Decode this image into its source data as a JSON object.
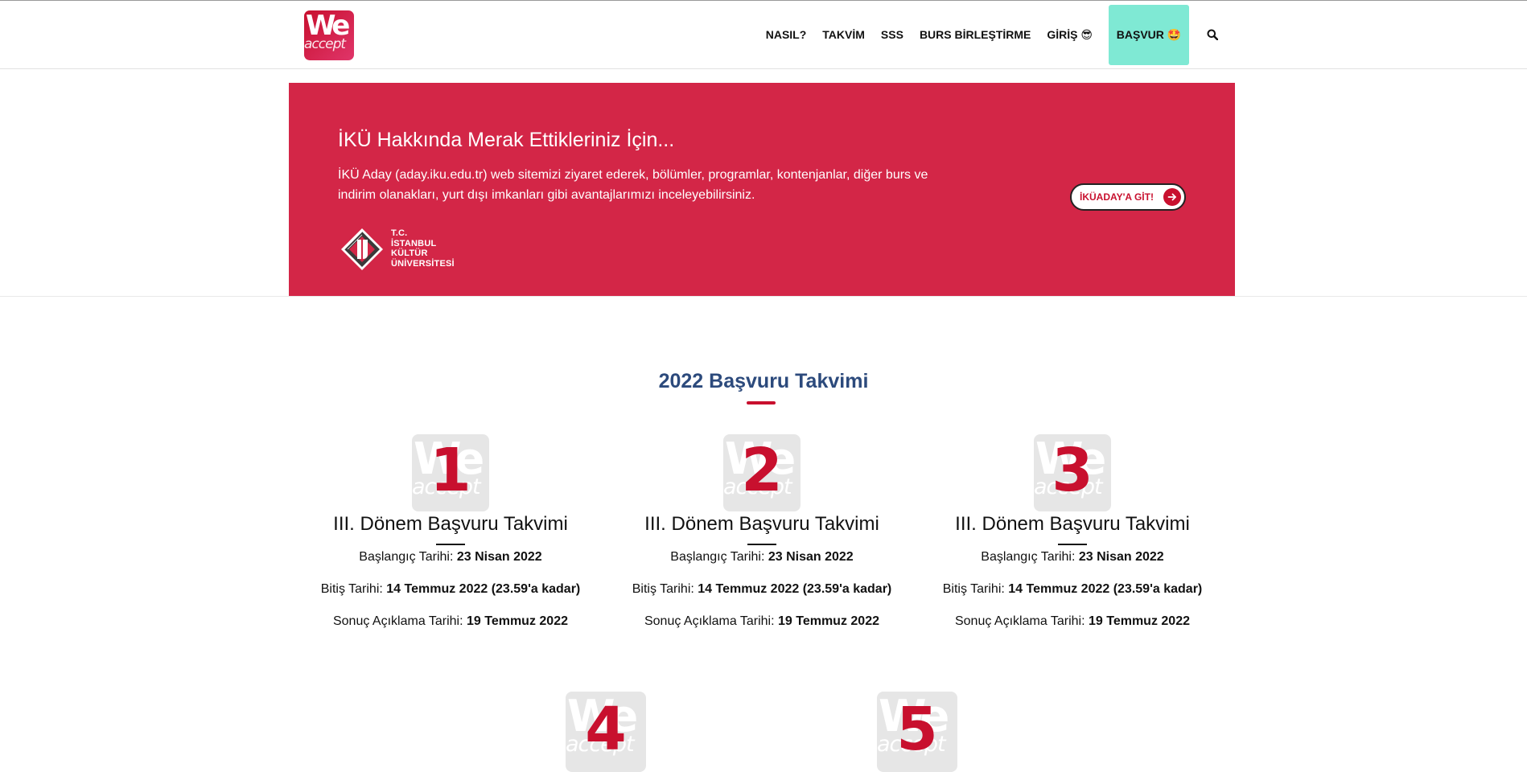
{
  "header": {
    "logo": {
      "line1": "We",
      "line2": "accept"
    },
    "nav": [
      {
        "label": "NASIL?"
      },
      {
        "label": "TAKVİM"
      },
      {
        "label": "SSS"
      },
      {
        "label": "BURS BİRLEŞTİRME"
      },
      {
        "label": "GİRİŞ 😎"
      }
    ],
    "cta_label": "BAŞVUR 🤩",
    "search_icon": "search-icon"
  },
  "banner": {
    "title": "İKÜ Hakkında Merak Ettikleriniz İçin...",
    "text": "İKÜ Aday (aday.iku.edu.tr) web sitemizi ziyaret ederek, bölümler, programlar, kontenjanlar, diğer burs ve indirim olanakları, yurt dışı imkanları gibi avantajlarımızı inceleyebilirsiniz.",
    "university_logo": {
      "line1": "T.C.",
      "line2": "İSTANBUL",
      "line3": "KÜLTÜR",
      "line4": "ÜNİVERSİTESİ"
    },
    "button_label": "İKÜADAY'A GİT!",
    "accent_color": "#d32647"
  },
  "calendar": {
    "title": "2022 Başvuru Takvimi",
    "cards": [
      {
        "number": "1",
        "title": "III. Dönem Başvuru Takvimi",
        "start_label": "Başlangıç Tarihi: ",
        "start_value": "23 Nisan 2022",
        "end_label": "Bitiş Tarihi: ",
        "end_value": "14 Temmuz 2022 (23.59'a kadar)",
        "result_label": "Sonuç Açıklama Tarihi: ",
        "result_value": "19 Temmuz 2022"
      },
      {
        "number": "2",
        "title": "III. Dönem Başvuru Takvimi",
        "start_label": "Başlangıç Tarihi: ",
        "start_value": "23 Nisan 2022",
        "end_label": "Bitiş Tarihi: ",
        "end_value": "14 Temmuz 2022 (23.59'a kadar)",
        "result_label": "Sonuç Açıklama Tarihi: ",
        "result_value": "19 Temmuz 2022"
      },
      {
        "number": "3",
        "title": "III. Dönem Başvuru Takvimi",
        "start_label": "Başlangıç Tarihi: ",
        "start_value": "23 Nisan 2022",
        "end_label": "Bitiş Tarihi: ",
        "end_value": "14 Temmuz 2022 (23.59'a kadar)",
        "result_label": "Sonuç Açıklama Tarihi: ",
        "result_value": "19 Temmuz 2022"
      },
      {
        "number": "4"
      },
      {
        "number": "5"
      }
    ]
  },
  "colors": {
    "brand_red": "#c8102e",
    "cta_mint": "#7fe9d4",
    "title_blue": "#2c4a7c"
  }
}
